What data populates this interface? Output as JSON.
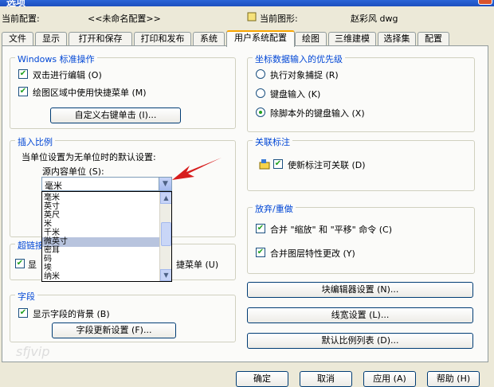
{
  "window": {
    "title": "选项"
  },
  "info": {
    "profile_label": "当前配置:",
    "profile_value": "<<未命名配置>>",
    "drawing_label": "当前图形:",
    "drawing_value": "赵彩风 dwg"
  },
  "tabs": [
    {
      "label": "文件"
    },
    {
      "label": "显示"
    },
    {
      "label": "打开和保存"
    },
    {
      "label": "打印和发布"
    },
    {
      "label": "系统"
    },
    {
      "label": "用户系统配置"
    },
    {
      "label": "绘图"
    },
    {
      "label": "三维建模"
    },
    {
      "label": "选择集"
    },
    {
      "label": "配置"
    }
  ],
  "windows_ops": {
    "title": "Windows 标准操作",
    "double_click": "双击进行编辑 (O)",
    "shortcut_menu": "绘图区域中使用快捷菜单 (M)",
    "right_click_btn": "自定义右键单击 (I)..."
  },
  "coord_priority": {
    "title": "坐标数据输入的优先级",
    "options": [
      {
        "label": "执行对象捕捉 (R)",
        "selected": false
      },
      {
        "label": "键盘输入 (K)",
        "selected": false
      },
      {
        "label": "除脚本外的键盘输入 (X)",
        "selected": true
      }
    ]
  },
  "insert_scale": {
    "title": "插入比例",
    "desc": "当单位设置为无单位时的默认设置:",
    "source_label": "源内容单位 (S):",
    "source_value": "毫米",
    "list_items": [
      "毫米",
      "英寸",
      "英尺",
      "米",
      "千米",
      "微英寸",
      "密耳",
      "码",
      "埃",
      "纳米"
    ],
    "selected_index": 5
  },
  "hyperlink": {
    "title": "超链接",
    "check_label": "显示超链接光标、工具提示和快捷菜单 (U)",
    "partial_prefix": "显",
    "partial_suffix": "捷菜单 (U)"
  },
  "associative": {
    "title": "关联标注",
    "check_label": "使新标注可关联 (D)"
  },
  "undo_redo": {
    "title": "放弃/重做",
    "combine_zoom": "合并 \"缩放\" 和 \"平移\" 命令 (C)",
    "combine_layer": "合并图层特性更改 (Y)"
  },
  "fields": {
    "title": "字段",
    "show_bg": "显示字段的背景 (B)",
    "update_btn": "字段更新设置 (F)..."
  },
  "right_buttons": {
    "block_editor": "块编辑器设置 (N)...",
    "lineweight": "线宽设置 (L)...",
    "scale_list": "默认比例列表 (D)..."
  },
  "footer": {
    "ok": "确定",
    "cancel": "取消",
    "apply": "应用 (A)",
    "help": "帮助 (H)"
  },
  "watermark": "sfjvip"
}
